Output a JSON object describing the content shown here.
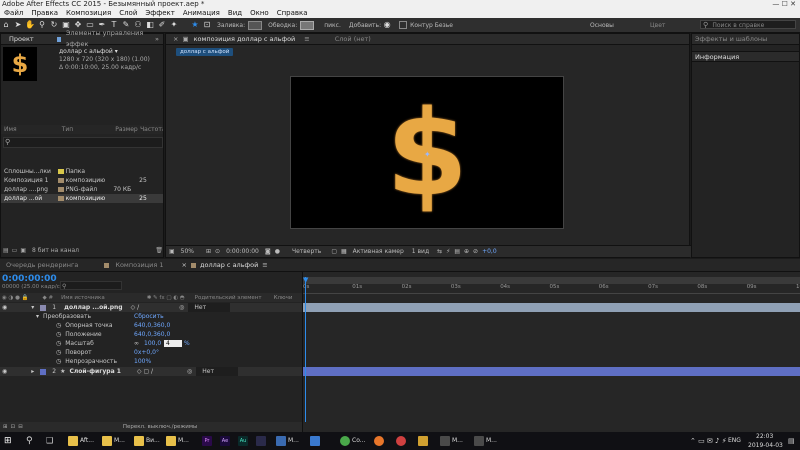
{
  "window": {
    "title": "Adobe After Effects CC 2015 - Безымянный проект.aep *"
  },
  "menu": [
    "Файл",
    "Правка",
    "Композиция",
    "Слой",
    "Эффект",
    "Анимация",
    "Вид",
    "Окно",
    "Справка"
  ],
  "toolbar": {
    "fill_label": "Заливка:",
    "stroke_label": "Обводка:",
    "stroke_px": "пикс.",
    "add_label": "Добавить:",
    "bezier_label": "Контур Безье",
    "workspace_basic": "Основы",
    "workspace_color": "Цвет",
    "search_placeholder": "Поиск в справке"
  },
  "project_panel": {
    "tab_project": "Проект",
    "tab_effects": "Элементы управления эффек",
    "comp_name": "доллар с альфой ▾",
    "comp_info1": "1280 x 720  (320 x 180) (1.00)",
    "comp_info2": "Δ 0:00:10:00, 25.00 кадр/с",
    "columns": [
      "Имя",
      "Тип",
      "Размер",
      "Частота"
    ],
    "items": [
      {
        "name": "Сплошны...лки",
        "type": "Папка",
        "size": "",
        "rate": "",
        "color": "#d9c84a"
      },
      {
        "name": "Композиция 1",
        "type": "композицию",
        "size": "",
        "rate": "25",
        "color": "#a38c6b"
      },
      {
        "name": "доллар ....png",
        "type": "PNG-файл",
        "size": "70 КБ",
        "rate": "",
        "color": "#a38c6b"
      },
      {
        "name": "доллар ...ой",
        "type": "композицию",
        "size": "",
        "rate": "25",
        "color": "#a38c6b"
      }
    ],
    "bit_depth": "8 бит на канал"
  },
  "comp_viewer": {
    "tab_label": "композиция доллар с альфой",
    "tab_layer": "Слой (нет)",
    "breadcrumb": "доллар с альфой",
    "zoom": "50%",
    "time": "0:00:00:00",
    "resolution": "Четверть",
    "camera": "Активная камер",
    "views": "1 вид",
    "exposure": "+0,0",
    "symbol": "$"
  },
  "right_panel": {
    "effects_tab": "Эффекты и шаблоны",
    "info_tab": "Информация"
  },
  "timeline": {
    "tab_render": "Очередь рендеринга",
    "tab_comp1": "Композиция 1",
    "tab_active": "доллар с альфой",
    "timecode": "0:00:00:00",
    "timecode_sub": "00000 (25.00 кадр/с)",
    "col_layer": "Имя источника",
    "col_parent": "Родительский элемент",
    "col_keys": "Ключи",
    "ruler": [
      "0s",
      "01s",
      "02s",
      "03s",
      "04s",
      "05s",
      "06s",
      "07s",
      "08s",
      "09s",
      "10"
    ],
    "layers": [
      {
        "num": "1",
        "name": "доллар ...ой.png",
        "parent": "Нет"
      },
      {
        "num": "2",
        "name": "Слой-фигура 1",
        "parent": "Нет"
      }
    ],
    "transform": {
      "label": "Преобразовать",
      "reset": "Сбросить",
      "props": [
        {
          "name": "Опорная точка",
          "value": "640,0,360,0"
        },
        {
          "name": "Положение",
          "value": "640,0,360,0"
        },
        {
          "name": "Масштаб",
          "value": "100,0",
          "value2": "4",
          "unit": "%"
        },
        {
          "name": "Поворот",
          "value": "0x+0,0°"
        },
        {
          "name": "Непрозрачность",
          "value": "100%"
        }
      ]
    },
    "footer": "Перекл. выключ./режимы"
  },
  "taskbar": {
    "items": [
      "Aft...",
      "M...",
      "Ви...",
      "M...",
      "M...",
      "Co...",
      "M...",
      "M..."
    ],
    "lang": "ENG",
    "time": "22:03",
    "date": "2019-04-03"
  },
  "colors": {
    "accent": "#2d8ceb",
    "dollar": "#e8a844",
    "layer_bar1": "#8fa0b5",
    "layer_bar2": "#5f6fc4"
  }
}
